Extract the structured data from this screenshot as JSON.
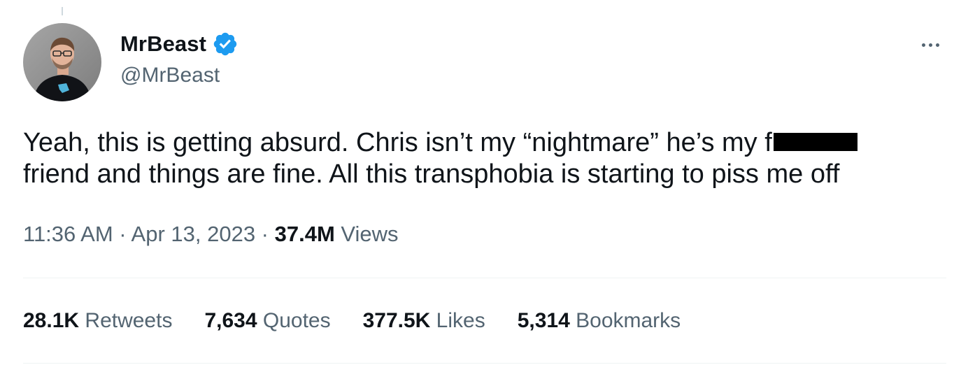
{
  "author": {
    "display_name": "MrBeast",
    "handle": "@MrBeast",
    "avatar_icon": "avatar-photo",
    "verified_icon": "verified-badge-icon",
    "verified_color": "#1d9bf0"
  },
  "menu": {
    "more_icon": "more-horizontal-icon"
  },
  "tweet": {
    "line1": "Yeah, this is getting absurd. Chris isn’t my “nightmare” he’s my f",
    "line1_redacted": true,
    "line2": "friend and things are fine. All this transphobia is starting to piss me off"
  },
  "meta": {
    "time": "11:36 AM",
    "sep1": " · ",
    "date": "Apr 13, 2023",
    "sep2": " · ",
    "views_count": "37.4M",
    "views_label": " Views"
  },
  "stats": [
    {
      "count": "28.1K",
      "label": " Retweets"
    },
    {
      "count": "7,634",
      "label": " Quotes"
    },
    {
      "count": "377.5K",
      "label": " Likes"
    },
    {
      "count": "5,314",
      "label": " Bookmarks"
    }
  ],
  "colors": {
    "text_primary": "#0f1419",
    "text_secondary": "#536471",
    "divider": "#eff3f4",
    "redaction": "#000000"
  }
}
